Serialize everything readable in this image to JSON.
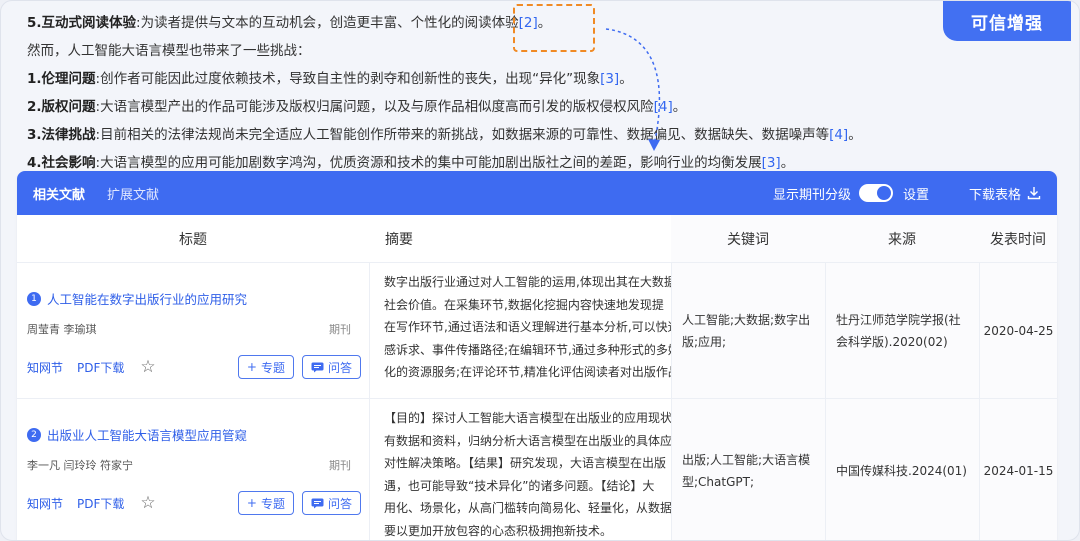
{
  "content": {
    "line1": {
      "num": "5.",
      "title": "互动式阅读体验",
      "text": ":为读者提供与文本的互动机会，创造更丰富、个性化的阅读体验",
      "cite": "[2]",
      "end": "。"
    },
    "line2": {
      "text": "然而，人工智能大语言模型也带来了一些挑战："
    },
    "line3": {
      "num": "1.",
      "title": "伦理问题",
      "text": ":创作者可能因此过度依赖技术，导致自主性的剥夺和创新性的丧失，出现“异化”现象",
      "cite": "[3]",
      "end": "。"
    },
    "line4": {
      "num": "2.",
      "title": "版权问题",
      "text": ":大语言模型产出的作品可能涉及版权归属问题，以及与原作品相似度高而引发的版权侵权风险",
      "cite": "[4]",
      "end": "。"
    },
    "line5": {
      "num": "3.",
      "title": "法律挑战",
      "text": ":目前相关的法律法规尚未完全适应人工智能创作所带来的新挑战，如数据来源的可靠性、数据偏见、数据缺失、数据噪声等",
      "cite": "[4]",
      "end": "。"
    },
    "line6": {
      "num": "4.",
      "title": "社会影响",
      "text": ":大语言模型的应用可能加剧数字鸿沟，优质资源和技术的集中可能加剧出版社之间的差距，影响行业的均衡发展",
      "cite": "[3]",
      "end": "。"
    }
  },
  "badge": {
    "label": "可信增强"
  },
  "panel": {
    "tabs": [
      "相关文献",
      "扩展文献"
    ],
    "toggle_label": "显示期刊分级",
    "settings": "设置",
    "download": "下载表格"
  },
  "table": {
    "headers": {
      "title": "标题",
      "abstract": "摘要",
      "keywords": "关键词",
      "source": "来源",
      "date": "发表时间"
    },
    "rows": [
      {
        "num": "1",
        "title": "人工智能在数字出版行业的应用研究",
        "authors": "周莹青 李瑜琪",
        "type": "期刊",
        "links": [
          "知网节",
          "PDF下载"
        ],
        "btn_topic": "专题",
        "btn_ask": "问答",
        "abstract": [
          "数字出版行业通过对人工智能的运用,体现出其在大数据",
          "社会价值。在采集环节,数据化挖掘内容快速地发现提",
          "在写作环节,通过语法和语义理解进行基本分析,可以快速",
          "感诉求、事件传播路径;在编辑环节,通过多种形式的多媒",
          "化的资源服务;在评论环节,精准化评估阅读者对出版作品"
        ],
        "keywords": "人工智能;大数据;数字出版;应用;",
        "source": "牡丹江师范学院学报(社会科学版).2020(02)",
        "date": "2020-04-25"
      },
      {
        "num": "2",
        "title": "出版业人工智能大语言模型应用管窥",
        "authors": "李一凡 闫玲玲 符家宁",
        "type": "期刊",
        "links": [
          "知网节",
          "PDF下载"
        ],
        "btn_topic": "专题",
        "btn_ask": "问答",
        "abstract": [
          "【目的】探讨人工智能大语言模型在出版业的应用现状",
          "有数据和资料，归纳分析大语言模型在出版业的具体应",
          "对性解决策略。【结果】研究发现，大语言模型在出版",
          "遇，也可能导致“技术异化”的诸多问题。【结论】大",
          "用化、场景化，从高门槛转向简易化、轻量化，从数据",
          "要以更加开放包容的心态积极拥抱新技术。"
        ],
        "keywords": "出版;人工智能;大语言模型;ChatGPT;",
        "source": "中国传媒科技.2024(01)",
        "date": "2024-01-15"
      }
    ]
  },
  "colors": {
    "accent": "#3e6bf1",
    "highlight": "#f08a24",
    "link": "#2f5fe8"
  }
}
